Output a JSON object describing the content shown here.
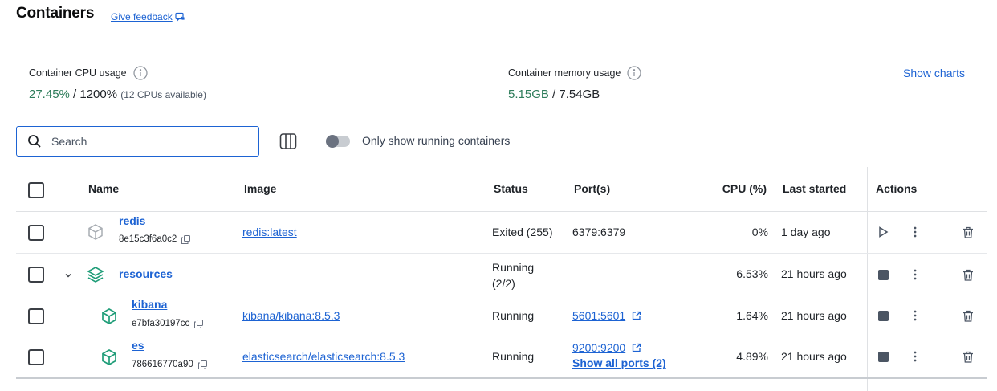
{
  "header": {
    "title": "Containers",
    "feedback_label": "Give feedback"
  },
  "usage": {
    "cpu_label": "Container CPU usage",
    "cpu_used": "27.45%",
    "cpu_total": " / 1200%",
    "cpu_note": "(12 CPUs available)",
    "mem_label": "Container memory usage",
    "mem_used": "5.15GB",
    "mem_total": " / 7.54GB",
    "show_charts": "Show charts"
  },
  "toolbar": {
    "search_placeholder": "Search",
    "toggle_label": "Only show running containers",
    "toggle_on": false
  },
  "table": {
    "columns": {
      "name": "Name",
      "image": "Image",
      "status": "Status",
      "ports": "Port(s)",
      "cpu": "CPU (%)",
      "last_started": "Last started",
      "actions": "Actions"
    },
    "rows": [
      {
        "name": "redis",
        "id": "8e15c3f6a0c2",
        "image": "redis:latest",
        "status": "Exited (255)",
        "ports": "6379:6379",
        "cpu": "0%",
        "last_started": "1 day ago"
      },
      {
        "name": "resources",
        "status_line1": "Running",
        "status_line2": "(2/2)",
        "cpu": "6.53%",
        "last_started": "21 hours ago"
      },
      {
        "name": "kibana",
        "id": "e7bfa30197cc",
        "image": "kibana/kibana:8.5.3",
        "status": "Running",
        "ports": "5601:5601",
        "cpu": "1.64%",
        "last_started": "21 hours ago"
      },
      {
        "name": "es",
        "id": "786616770a90",
        "image": "elasticsearch/elasticsearch:8.5.3",
        "status": "Running",
        "ports": "9200:9200",
        "ports_more": "Show all ports (2)",
        "cpu": "4.89%",
        "last_started": "21 hours ago"
      }
    ]
  },
  "icons": {
    "feedback": "feedback-icon",
    "info": "info-icon",
    "search": "search-icon",
    "columns": "columns-icon",
    "container": "cube-icon",
    "stack": "layers-icon",
    "copy": "copy-icon",
    "external": "external-link-icon",
    "start": "play-icon",
    "stop": "stop-icon",
    "more": "more-vertical-icon",
    "delete": "trash-icon",
    "expand": "chevron-down-icon"
  },
  "colors": {
    "accent": "#1d63d3",
    "usage_green": "#2e7d5b",
    "container_running": "#1f9d78",
    "container_stopped": "#a8adb3"
  }
}
